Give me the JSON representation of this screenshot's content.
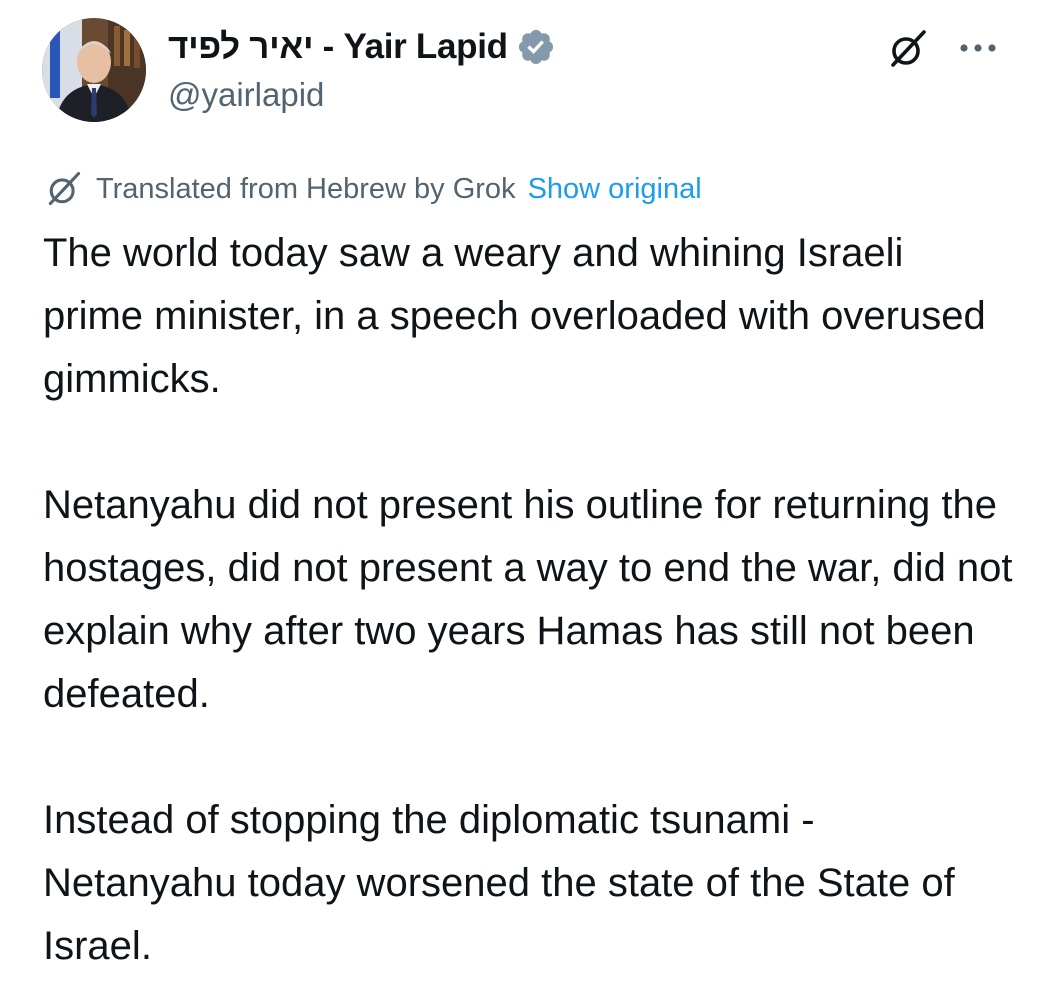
{
  "author": {
    "display_name": "יאיר לפיד - Yair Lapid",
    "handle": "@yairlapid",
    "verified_badge_icon": "verified-badge-icon",
    "badge_color": "#829aab"
  },
  "header_actions": {
    "grok_icon": "grok-icon",
    "more_icon": "more-horizontal-icon"
  },
  "translation": {
    "note": "Translated from Hebrew by Grok",
    "show_original_label": "Show original",
    "link_color": "#1d9bf0"
  },
  "post": {
    "paragraphs": [
      "The world today saw a weary and whining Israeli prime minister, in a speech overloaded with overused gimmicks.",
      "Netanyahu did not present his outline for returning the hostages, did not present a way to end the war, did not explain why after two years Hamas has still not been defeated.",
      "Instead of stopping the diplomatic tsunami - Netanyahu today worsened the state of the State of Israel."
    ]
  }
}
